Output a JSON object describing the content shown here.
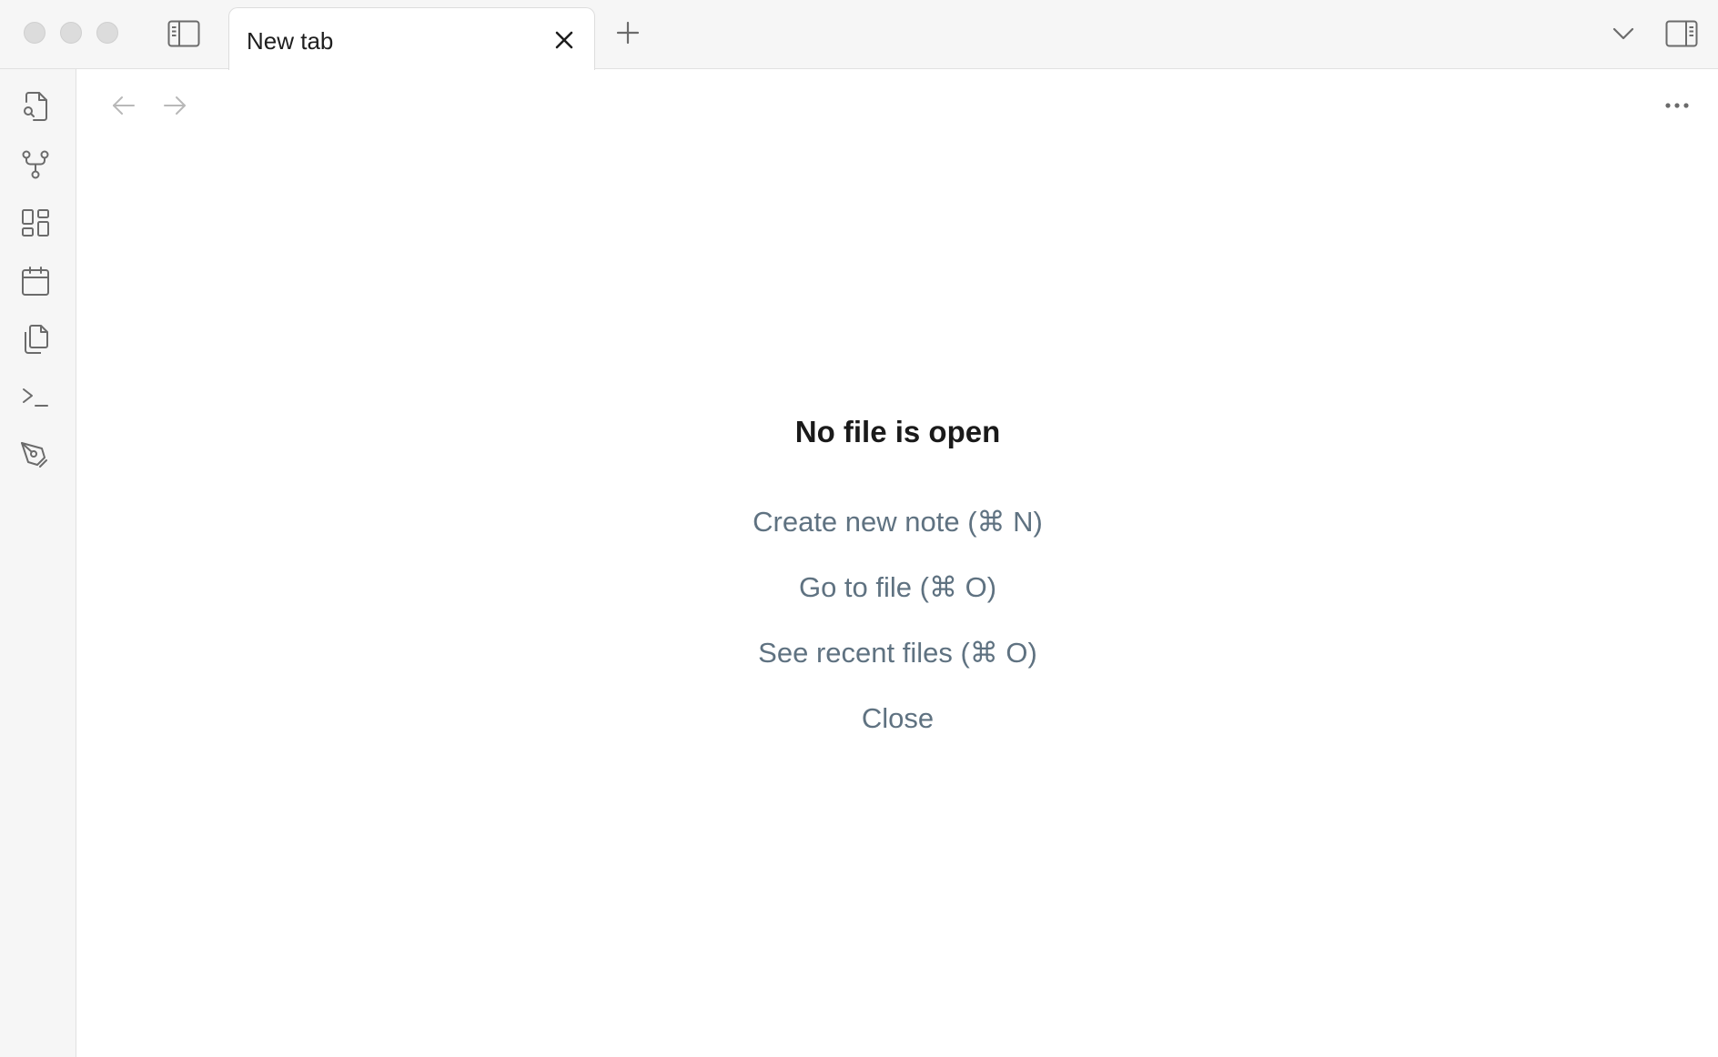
{
  "window": {
    "traffic_lights": [
      "close",
      "minimize",
      "maximize"
    ]
  },
  "titlebar": {
    "left_sidebar_toggle_icon": "sidebar-left-icon",
    "tab": {
      "title": "New tab",
      "close_icon": "close-icon"
    },
    "new_tab_icon": "plus-icon",
    "tab_list_icon": "chevron-down-icon",
    "right_sidebar_toggle_icon": "sidebar-right-icon"
  },
  "ribbon": {
    "items": [
      {
        "name": "search",
        "icon": "file-search-icon"
      },
      {
        "name": "graph",
        "icon": "git-fork-icon"
      },
      {
        "name": "canvas",
        "icon": "layout-dashboard-icon"
      },
      {
        "name": "daily-notes",
        "icon": "calendar-icon"
      },
      {
        "name": "templates",
        "icon": "files-icon"
      },
      {
        "name": "command-palette",
        "icon": "terminal-icon"
      },
      {
        "name": "excalidraw",
        "icon": "pen-tool-icon"
      }
    ]
  },
  "main": {
    "nav": {
      "back_icon": "arrow-left-icon",
      "forward_icon": "arrow-right-icon",
      "more_icon": "more-horizontal-icon"
    },
    "empty_state": {
      "title": "No file is open",
      "actions": [
        "Create new note (⌘ N)",
        "Go to file (⌘ O)",
        "See recent files (⌘ O)",
        "Close"
      ]
    }
  },
  "colors": {
    "action_text": "#5f7281",
    "chrome_bg": "#f6f6f6",
    "icon": "#6b6b6b"
  }
}
